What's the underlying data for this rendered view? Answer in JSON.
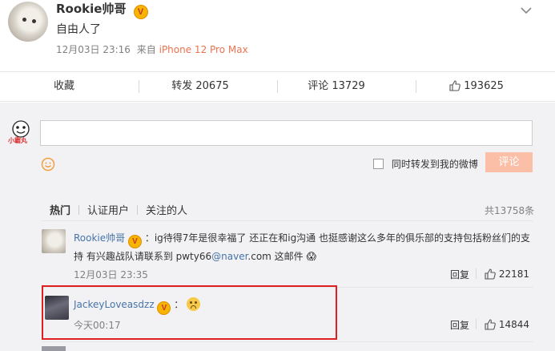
{
  "post": {
    "author": "Rookie帅哥",
    "text": "自由人了",
    "time": "12月03日 23:16",
    "source_prefix": "来自",
    "source": "iPhone 12 Pro Max",
    "badge": "V"
  },
  "stats": {
    "favorite": "收藏",
    "repost": "转发 20675",
    "comment": "评论 13729",
    "like": "193625"
  },
  "composer": {
    "avatar_text": "小霸丸",
    "also_repost_label": "同时转发到我的微博",
    "submit_label": "评论"
  },
  "tabs": {
    "hot": "热门",
    "verified": "认证用户",
    "following": "关注的人",
    "total": "共13758条"
  },
  "comments": [
    {
      "author": "Rookie帅哥",
      "line1": "ig待得7年是很幸福了 还正在和ig沟通 也挺感谢这么多年的俱乐部的支持包括粉丝们的支",
      "line2_prefix": "持 有兴趣战队请联系到 pwty66",
      "line2_link": "@naver",
      "line2_suffix": ".com 这邮件",
      "time": "12月03日 23:35",
      "reply": "回复",
      "likes": "22181"
    },
    {
      "author": "JackeyLoveasdzz",
      "time": "今天00:17",
      "reply": "回复",
      "likes": "14844"
    }
  ],
  "colors": {
    "accent": "#eb7350",
    "link_blue": "#4673a8",
    "highlight_border": "#e02020",
    "submit_disabled": "#fbbfa8"
  }
}
